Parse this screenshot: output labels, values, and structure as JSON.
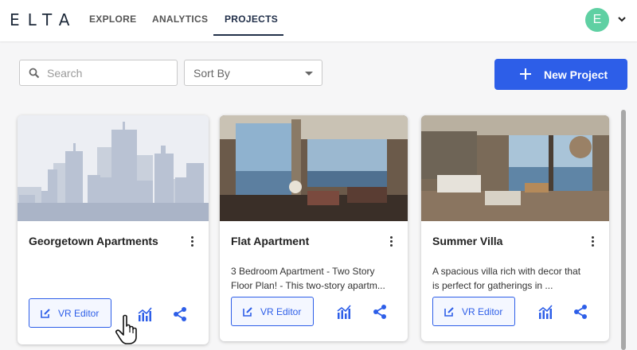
{
  "header": {
    "logo": "ELTA",
    "nav": [
      {
        "label": "EXPLORE"
      },
      {
        "label": "ANALYTICS"
      },
      {
        "label": "PROJECTS",
        "active": true
      }
    ],
    "avatar_initial": "E"
  },
  "toolbar": {
    "search_placeholder": "Search",
    "sort_label": "Sort By",
    "new_project_label": "New Project"
  },
  "projects": [
    {
      "title": "Georgetown Apartments",
      "description": "",
      "vr_label": "VR Editor"
    },
    {
      "title": "Flat Apartment",
      "description": "3 Bedroom Apartment - Two Story\nFloor Plan! - This two-story apartm...",
      "vr_label": "VR Editor"
    },
    {
      "title": "Summer Villa",
      "description": "A spacious villa rich with decor that\nis perfect for gatherings in ...",
      "vr_label": "VR Editor"
    }
  ],
  "colors": {
    "accent": "#2d5ee8",
    "header_text": "#22304a",
    "avatar": "#5fd0a3",
    "skyline": "#b9c2d3"
  },
  "icons": [
    "search-icon",
    "caret-down-icon",
    "plus-icon",
    "more-vert-icon",
    "edit-icon",
    "analytics-icon",
    "share-icon",
    "hand-pointer-icon"
  ]
}
